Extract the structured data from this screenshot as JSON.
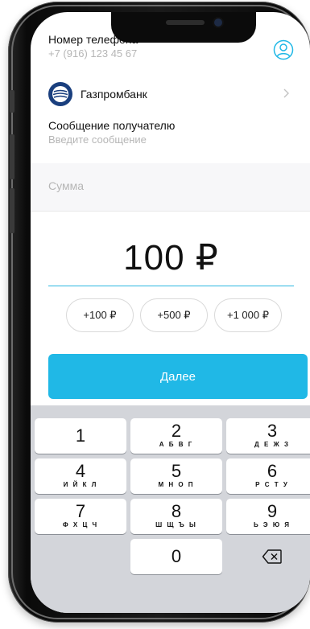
{
  "form": {
    "phone_label": "Номер телефона",
    "phone_value": "+7 (916) 123 45 67",
    "bank_name": "Газпромбанк",
    "message_label": "Сообщение получателю",
    "message_placeholder": "Введите сообщение",
    "amount_placeholder": "Сумма",
    "amount_value": "100 ₽"
  },
  "quick_amounts": [
    "+100 ₽",
    "+500 ₽",
    "+1 000 ₽"
  ],
  "next_button": "Далее",
  "keypad": [
    {
      "num": "1",
      "letters": ""
    },
    {
      "num": "2",
      "letters": "А Б В Г"
    },
    {
      "num": "3",
      "letters": "Д Е Ж З"
    },
    {
      "num": "4",
      "letters": "И Й К Л"
    },
    {
      "num": "5",
      "letters": "М Н О П"
    },
    {
      "num": "6",
      "letters": "Р С Т У"
    },
    {
      "num": "7",
      "letters": "Ф Х Ц Ч"
    },
    {
      "num": "8",
      "letters": "Ш Щ Ъ Ы"
    },
    {
      "num": "9",
      "letters": "Ь Э Ю Я"
    },
    {
      "num": "0",
      "letters": ""
    }
  ],
  "icons": {
    "profile": "user-circle-icon",
    "bank_logo": "gazprombank-logo",
    "chevron": "chevron-right-icon",
    "backspace": "backspace-icon"
  },
  "colors": {
    "accent": "#20b8e6",
    "bank_logo": "#1a3f7e",
    "keypad_bg": "#d3d5da"
  }
}
